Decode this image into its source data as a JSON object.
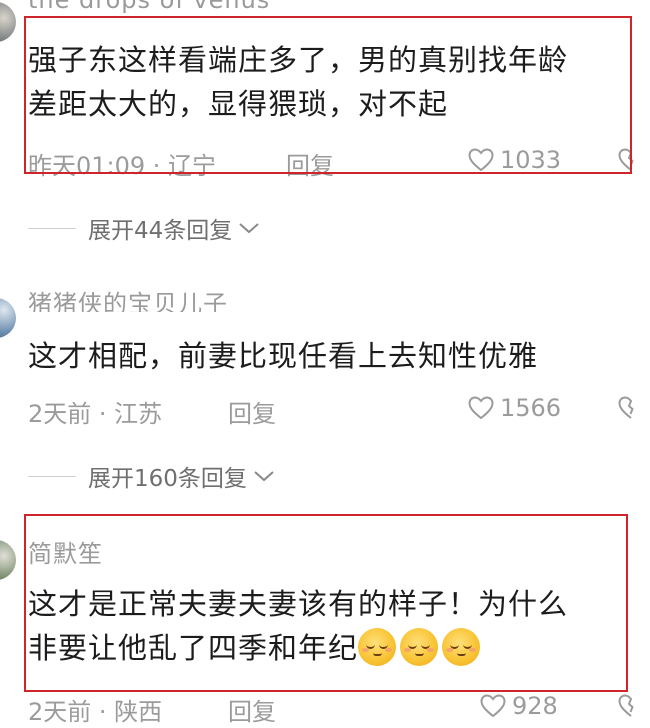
{
  "comments": [
    {
      "username": "the drops of venus",
      "content_lines": [
        "强子东这样看端庄多了，男的真别找年龄",
        "差距太大的，显得猥琐，对不起"
      ],
      "time_location": "昨天01:09 · 辽宁",
      "reply_label": "回复",
      "likes": "1033"
    },
    {
      "username": "猪猪侠的宝贝儿子",
      "content_lines": [
        "这才相配，前妻比现任看上去知性优雅"
      ],
      "time_location": "2天前 · 江苏",
      "reply_label": "回复",
      "likes": "1566"
    },
    {
      "username": "简默笙",
      "content_lines": [
        "这才是正常夫妻夫妻该有的样子！为什么",
        "非要让他乱了四季和年纪"
      ],
      "emoji_count": 3,
      "emoji_name": "shy-smile-emoji",
      "time_location": "2天前 · 陕西",
      "reply_label": "回复",
      "likes": "928"
    }
  ],
  "expand_replies": [
    {
      "label": "展开44条回复"
    },
    {
      "label": "展开160条回复"
    }
  ],
  "colors": {
    "highlight_border": "#d0242b",
    "meta_text": "#9b9b9b",
    "content_text": "#1c1c1c"
  }
}
